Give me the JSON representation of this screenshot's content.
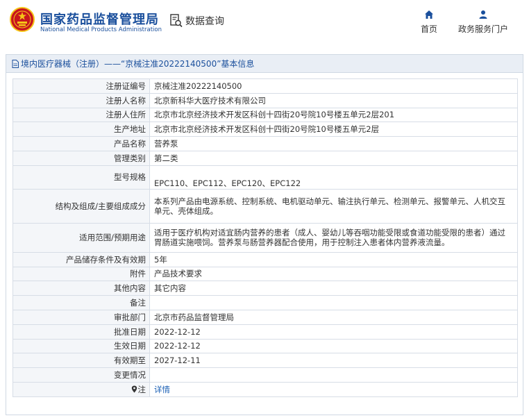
{
  "header": {
    "brand_cn": "国家药品监督管理局",
    "brand_en": "National Medical Products Administration",
    "query_label": "数据查询",
    "nav": [
      {
        "label": "首页",
        "icon": "home-icon"
      },
      {
        "label": "政务服务门户",
        "icon": "user-icon"
      }
    ]
  },
  "panel": {
    "title": "境内医疗器械（注册）——“京械注准20222140500”基本信息"
  },
  "rows": [
    {
      "key": "注册证编号",
      "value": "京械注准20222140500"
    },
    {
      "key": "注册人名称",
      "value": "北京新科华大医疗技术有限公司"
    },
    {
      "key": "注册人住所",
      "value": "北京市北京经济技术开发区科创十四街20号院10号楼五单元2层201"
    },
    {
      "key": "生产地址",
      "value": "北京市北京经济技术开发区科创十四街20号院10号楼五单元2层"
    },
    {
      "key": "产品名称",
      "value": "营养泵"
    },
    {
      "key": "管理类别",
      "value": "第二类"
    },
    {
      "key": "型号规格",
      "value": "EPC110、EPC112、EPC120、EPC122"
    },
    {
      "key": "结构及组成/主要组成成分",
      "value": "本系列产品由电源系统、控制系统、电机驱动单元、输注执行单元、检测单元、报警单元、人机交互单元、壳体组成。"
    },
    {
      "key": "适用范围/预期用途",
      "value": "适用于医疗机构对适宜肠内营养的患者（成人、婴幼儿等吞咽功能受限或食道功能受限的患者）通过胃肠道实施喂饲。营养泵与肠营养器配合使用，用于控制注入患者体内营养液流量。"
    },
    {
      "key": "产品储存条件及有效期",
      "value": "5年"
    },
    {
      "key": "附件",
      "value": "产品技术要求"
    },
    {
      "key": "其他内容",
      "value": "其它内容"
    },
    {
      "key": "备注",
      "value": ""
    },
    {
      "key": "审批部门",
      "value": "北京市药品监督管理局"
    },
    {
      "key": "批准日期",
      "value": "2022-12-12"
    },
    {
      "key": "生效日期",
      "value": "2022-12-12"
    },
    {
      "key": "有效期至",
      "value": "2027-12-11"
    },
    {
      "key": "变更情况",
      "value": ""
    },
    {
      "key": "注",
      "value": "详情"
    }
  ],
  "colors": {
    "brand": "#1a4f9c",
    "link": "#1a5fb4",
    "emblem_red": "#c8161d",
    "emblem_gold": "#f5c518"
  }
}
